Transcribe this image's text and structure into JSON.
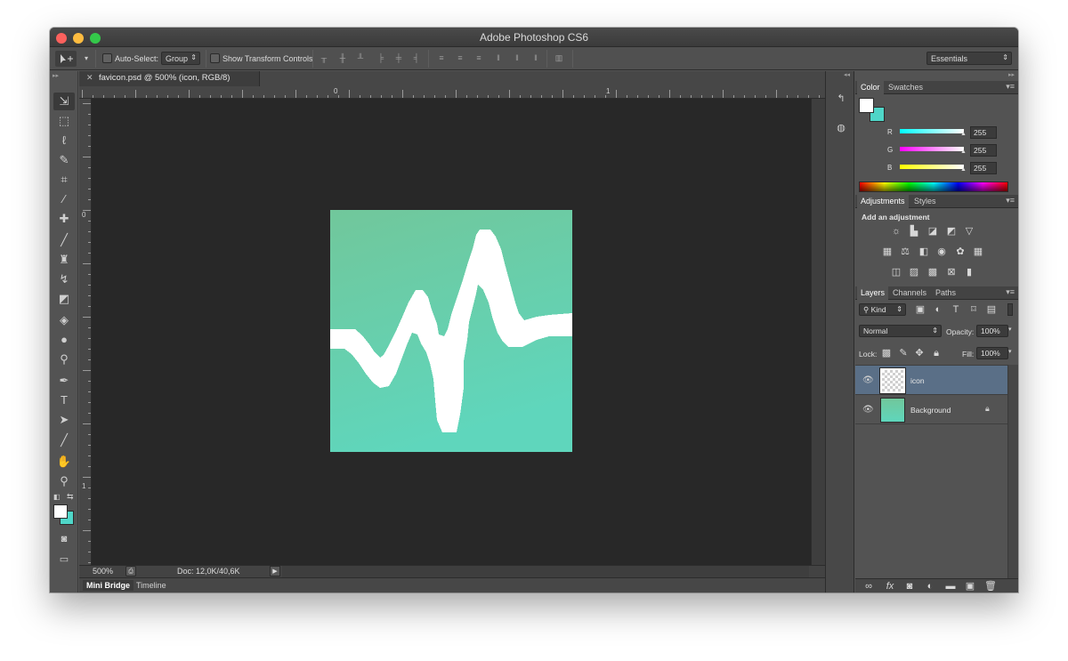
{
  "app": {
    "title": "Adobe Photoshop CS6"
  },
  "options_bar": {
    "auto_select_label": "Auto-Select:",
    "auto_select_value": "Group",
    "show_transform_label": "Show Transform Controls",
    "workspace": "Essentials"
  },
  "document": {
    "tab_title": "favicon.psd @ 500% (icon, RGB/8)",
    "ruler_h": [
      "0",
      "1"
    ],
    "ruler_v": [
      "0",
      "1"
    ],
    "canvas_colors": {
      "top": "#71c79b",
      "bottom": "#5fd6bc",
      "stroke": "#ffffff"
    },
    "zoom": "500%",
    "doc_size": "Doc: 12,0K/40,6K"
  },
  "bottom_panel": {
    "tabs": [
      "Mini Bridge",
      "Timeline"
    ]
  },
  "color_panel": {
    "tabs": [
      "Color",
      "Swatches"
    ],
    "channels": [
      {
        "label": "R",
        "value": "255",
        "color": "#00ffff"
      },
      {
        "label": "G",
        "value": "255",
        "color": "#ff00ff"
      },
      {
        "label": "B",
        "value": "255",
        "color": "#ffff00"
      }
    ],
    "foreground": "#ffffff",
    "background": "#4fd6c8"
  },
  "adjustments_panel": {
    "tabs": [
      "Adjustments",
      "Styles"
    ],
    "heading": "Add an adjustment"
  },
  "layers_panel": {
    "tabs": [
      "Layers",
      "Channels",
      "Paths"
    ],
    "kind_label": "Kind",
    "blend_mode": "Normal",
    "opacity_label": "Opacity:",
    "opacity_value": "100%",
    "lock_label": "Lock:",
    "fill_label": "Fill:",
    "fill_value": "100%",
    "layers": [
      {
        "name": "icon",
        "selected": true
      },
      {
        "name": "Background",
        "selected": false
      }
    ]
  }
}
